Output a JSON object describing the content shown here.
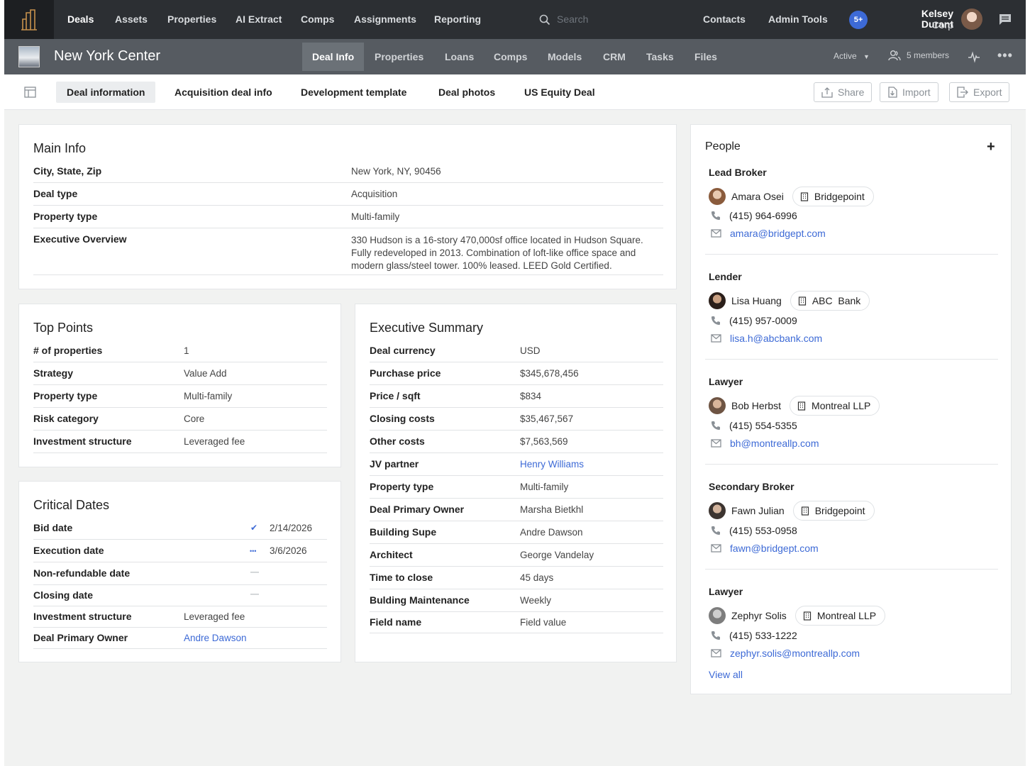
{
  "topnav": {
    "items": [
      "Deals",
      "Assets",
      "Properties",
      "AI Extract",
      "Comps",
      "Assignments",
      "Reporting"
    ],
    "search_placeholder": "Search",
    "right_links": [
      "Contacts",
      "Admin Tools"
    ],
    "notification_badge": "5+",
    "user_name": "Kelsey Durant",
    "user_org": "Corp"
  },
  "deal": {
    "title": "New York Center",
    "tabs": [
      "Deal Info",
      "Properties",
      "Loans",
      "Comps",
      "Models",
      "CRM",
      "Tasks",
      "Files"
    ],
    "status": "Active",
    "members": "5 members"
  },
  "subtabs": {
    "items": [
      "Deal information",
      "Acquisition deal info",
      "Development template",
      "Deal photos",
      "US Equity Deal"
    ],
    "share": "Share",
    "import": "Import",
    "export": "Export"
  },
  "main_info": {
    "title": "Main Info",
    "rows": [
      {
        "label": "City, State, Zip",
        "value": "New York, NY, 90456"
      },
      {
        "label": "Deal type",
        "value": "Acquisition"
      },
      {
        "label": "Property type",
        "value": "Multi-family"
      },
      {
        "label": "Executive Overview",
        "value": "330 Hudson is a 16-story 470,000sf office located in Hudson Square. Fully redeveloped in 2013. Combination of loft-like office space and modern glass/steel tower. 100% leased. LEED Gold Certified."
      }
    ]
  },
  "top_points": {
    "title": "Top Points",
    "rows": [
      {
        "label": "# of properties",
        "value": "1"
      },
      {
        "label": "Strategy",
        "value": "Value Add"
      },
      {
        "label": "Property type",
        "value": "Multi-family"
      },
      {
        "label": "Risk category",
        "value": "Core"
      },
      {
        "label": "Investment structure",
        "value": "Leveraged fee"
      }
    ]
  },
  "critical_dates": {
    "title": "Critical Dates",
    "rows": [
      {
        "label": "Bid date",
        "status": "✔",
        "value": "2/14/2026"
      },
      {
        "label": "Execution date",
        "status": "•••",
        "value": "3/6/2026"
      },
      {
        "label": "Non-refundable date",
        "status": "—",
        "value": ""
      },
      {
        "label": "Closing date",
        "status": "—",
        "value": ""
      },
      {
        "label": "Investment structure",
        "status": "",
        "value": "Leveraged fee"
      },
      {
        "label": "Deal Primary Owner",
        "status": "",
        "value": "Andre Dawson"
      }
    ]
  },
  "executive_summary": {
    "title": "Executive Summary",
    "rows": [
      {
        "label": "Deal currency",
        "value": "USD"
      },
      {
        "label": "Purchase price",
        "value": "$345,678,456"
      },
      {
        "label": "Price / sqft",
        "value": "$834"
      },
      {
        "label": "Closing costs",
        "value": "$35,467,567"
      },
      {
        "label": "Other costs",
        "value": "$7,563,569"
      },
      {
        "label": "JV partner",
        "value": "Henry Williams"
      },
      {
        "label": "Property type",
        "value": "Multi-family"
      },
      {
        "label": "Deal Primary Owner",
        "value": "Marsha Bietkhl"
      },
      {
        "label": "Building Supe",
        "value": "Andre Dawson"
      },
      {
        "label": "Architect",
        "value": "George Vandelay"
      },
      {
        "label": "Time to close",
        "value": "45 days"
      },
      {
        "label": "Bulding Maintenance",
        "value": "Weekly"
      },
      {
        "label": "Field name",
        "value": "Field value"
      }
    ]
  },
  "people": {
    "title": "People",
    "view_all": "View all",
    "contacts": [
      {
        "role": "Lead Broker",
        "name": "Amara Osei",
        "org": "Bridgepoint",
        "phone": "(415) 964-6996",
        "email": "amara@bridgept.com"
      },
      {
        "role": "Lender",
        "name": "Lisa Huang",
        "org": "ABC  Bank",
        "phone": "(415) 957-0009",
        "email": "lisa.h@abcbank.com"
      },
      {
        "role": "Lawyer",
        "name": "Bob Herbst",
        "org": "Montreal LLP",
        "phone": "(415) 554-5355",
        "email": "bh@montreallp.com"
      },
      {
        "role": "Secondary Broker",
        "name": "Fawn Julian",
        "org": "Bridgepoint",
        "phone": "(415) 553-0958",
        "email": "fawn@bridgept.com"
      },
      {
        "role": "Lawyer",
        "name": "Zephyr Solis",
        "org": "Montreal LLP",
        "phone": "(415) 533-1222",
        "email": "zephyr.solis@montreallp.com"
      }
    ]
  },
  "colors": {
    "accent": "#3d6ad6",
    "topnav": "#2c2f33",
    "dealbar": "#565b61",
    "page": "#f1f2f1"
  }
}
